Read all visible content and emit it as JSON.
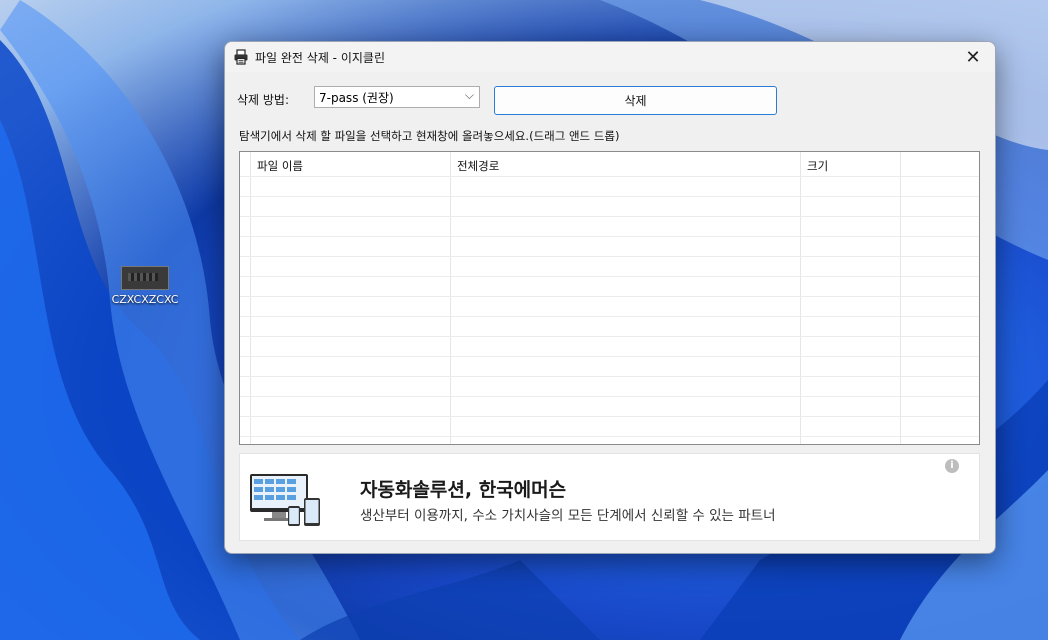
{
  "desktop": {
    "icon_label": "CZXCXZCXC"
  },
  "window": {
    "title": "파일 완전 삭제 - 이지클린",
    "close_glyph": "✕"
  },
  "controls": {
    "method_label": "삭제 방법:",
    "method_value": "7-pass (권장)",
    "delete_button": "삭제"
  },
  "instruction": "탐색기에서 삭제 할 파일을 선택하고 현재창에 올려놓으세요.(드래그 앤드 드롭)",
  "file_list": {
    "columns": [
      "파일 이름",
      "전체경로",
      "크기"
    ],
    "rows": []
  },
  "ad": {
    "title": "자동화솔루션, 한국에머슨",
    "subtitle": "생산부터 이용까지, 수소 가치사슬의 모든 단계에서 신뢰할 수 있는 파트너",
    "info_glyph": "i"
  }
}
